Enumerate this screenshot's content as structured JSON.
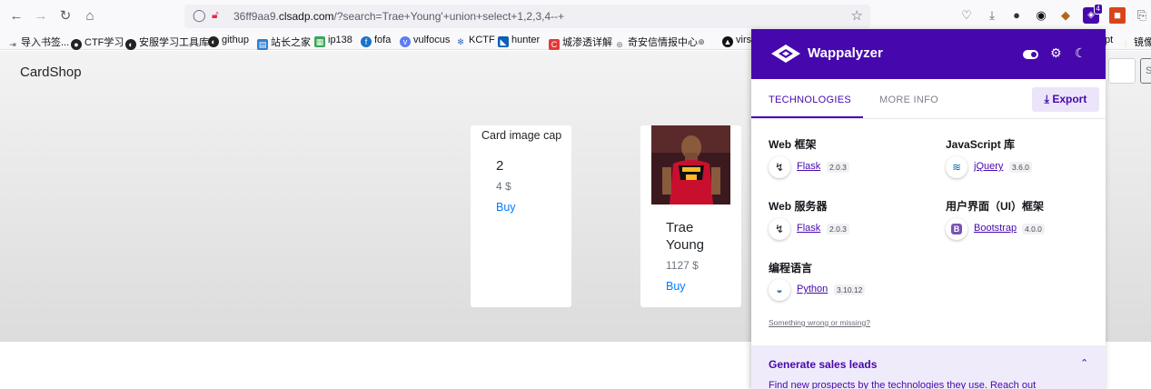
{
  "browser": {
    "url_prefix": "36ff9aa9.",
    "url_host": "clsadp.com",
    "url_path": "/?search=Trae+Young'+union+select+1,2,3,4--+",
    "extension_badge": "4"
  },
  "bookmarks": [
    {
      "label": "导入书签..."
    },
    {
      "label": "CTF学习"
    },
    {
      "label": "安服学习工具库"
    },
    {
      "label": "githup"
    },
    {
      "label": "站长之家"
    },
    {
      "label": "ip138"
    },
    {
      "label": "fofa"
    },
    {
      "label": "vulfocus"
    },
    {
      "label": "KCTF"
    },
    {
      "label": "hunter"
    },
    {
      "label": "城渗透详解"
    },
    {
      "label": "奇安信情报中心"
    },
    {
      "label": "virs"
    },
    {
      "label": "pt"
    },
    {
      "label": "镜像"
    }
  ],
  "page": {
    "brand": "CardShop",
    "search_btn_partial": "S",
    "cards": [
      {
        "image_alt": "Card image cap",
        "title": "2",
        "price": "4 $",
        "action": "Buy"
      },
      {
        "title": "Trae Young",
        "price": "1127 $",
        "action": "Buy"
      }
    ]
  },
  "wappalyzer": {
    "name": "Wappalyzer",
    "tabs": [
      "TECHNOLOGIES",
      "MORE INFO"
    ],
    "export_label": "Export",
    "categories": [
      {
        "name": "Web 框架",
        "tech": "Flask",
        "version": "2.0.3",
        "icon": "flask-icon"
      },
      {
        "name": "JavaScript 库",
        "tech": "jQuery",
        "version": "3.6.0",
        "icon": "jquery-icon"
      },
      {
        "name": "Web 服务器",
        "tech": "Flask",
        "version": "2.0.3",
        "icon": "flask-icon"
      },
      {
        "name": "用户界面（UI）框架",
        "tech": "Bootstrap",
        "version": "4.0.0",
        "icon": "bootstrap-icon"
      },
      {
        "name": "编程语言",
        "tech": "Python",
        "version": "3.10.12",
        "icon": "python-icon"
      }
    ],
    "something_wrong": "Something wrong or missing?",
    "leads_title": "Generate sales leads",
    "leads_text": "Find new prospects by the technologies they use. Reach out"
  },
  "colors": {
    "wappalyzer_purple": "#4608ad",
    "bootstrap_purple": "#7952b3",
    "link_blue": "#007bff"
  }
}
